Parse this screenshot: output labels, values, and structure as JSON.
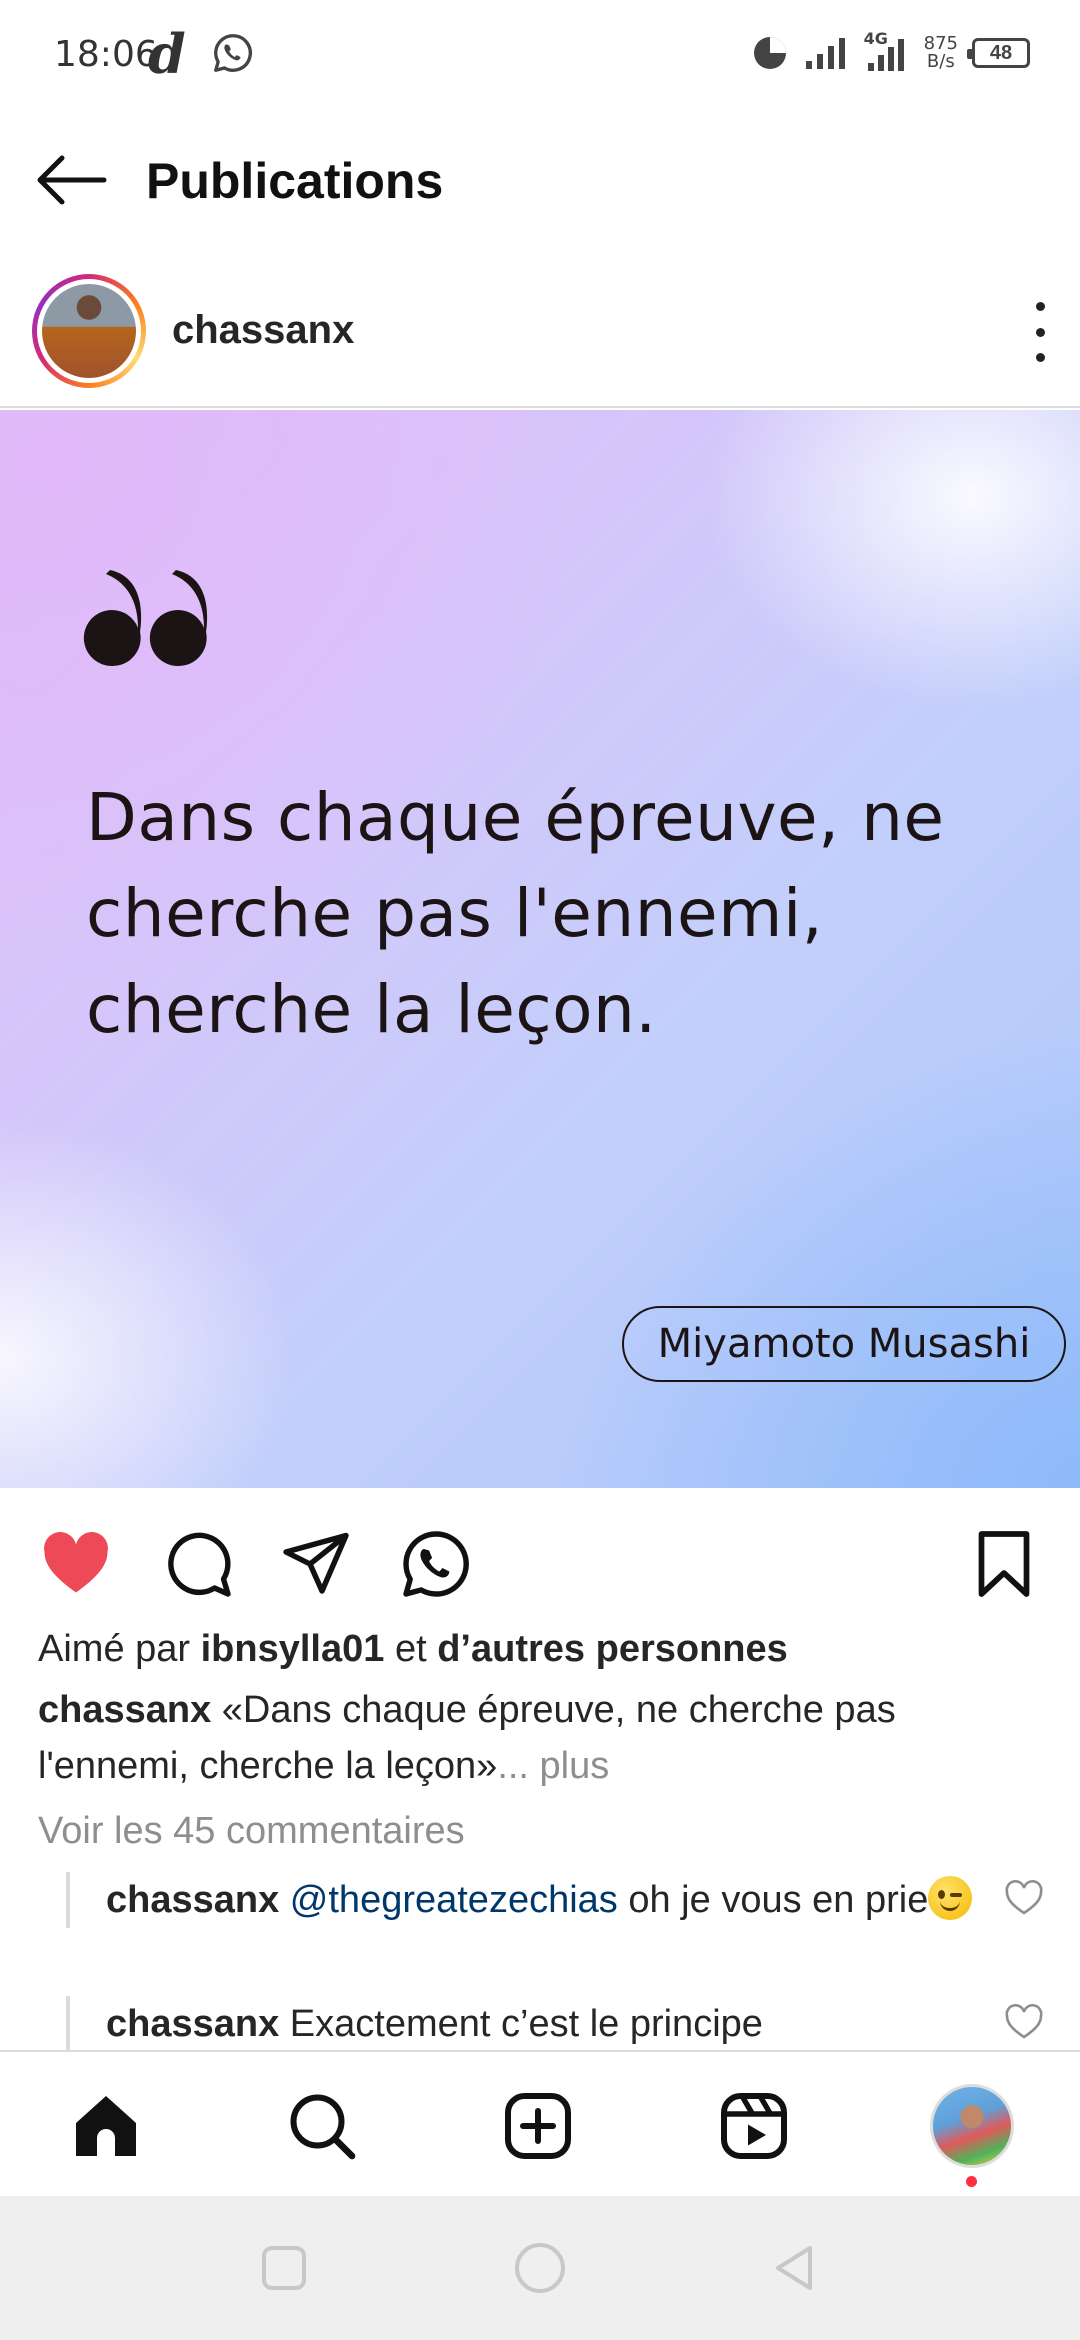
{
  "status_bar": {
    "time": "18:06",
    "app_glyph": "d",
    "network": "4G",
    "speed_value": "875",
    "speed_unit": "B/s",
    "battery": "48",
    "icons": [
      "whatsapp-icon",
      "data-saver-icon",
      "signal-icon",
      "signal-4g-icon",
      "battery-icon"
    ]
  },
  "header": {
    "title": "Publications",
    "back_icon": "back-arrow-icon"
  },
  "post": {
    "author": "chassanx",
    "image": {
      "quote": "Dans chaque épreuve, ne cherche pas l'ennemi, cherche la leçon.",
      "attribution": "Miyamoto Musashi",
      "colors": [
        "#e3bdf7",
        "#c3cffb",
        "#a9c6fb"
      ]
    },
    "actions": {
      "liked": true,
      "like_color": "#ed4956",
      "icons": [
        "heart-icon",
        "comment-icon",
        "share-icon",
        "whatsapp-icon",
        "bookmark-icon"
      ]
    },
    "likes": {
      "prefix": "Aimé par",
      "user": "ibnsylla01",
      "joiner": "et",
      "others": "d’autres personnes"
    },
    "caption": {
      "user": "chassanx",
      "text": "«Dans chaque épreuve, ne cherche pas l'ennemi, cherche la leçon»",
      "more": "... plus"
    },
    "view_comments": "Voir les 45 commentaires",
    "comments": [
      {
        "user": "chassanx",
        "mention": "@thegreatezechias",
        "text": "oh je vous en prie"
      },
      {
        "user": "chassanx",
        "mention": "",
        "text": "Exactement c’est le principe"
      }
    ]
  },
  "bottom_nav": {
    "items": [
      "home-icon",
      "search-icon",
      "create-icon",
      "reels-icon",
      "profile-avatar"
    ]
  },
  "system_nav": {
    "items": [
      "recents-icon",
      "home-circle-icon",
      "back-triangle-icon"
    ]
  }
}
